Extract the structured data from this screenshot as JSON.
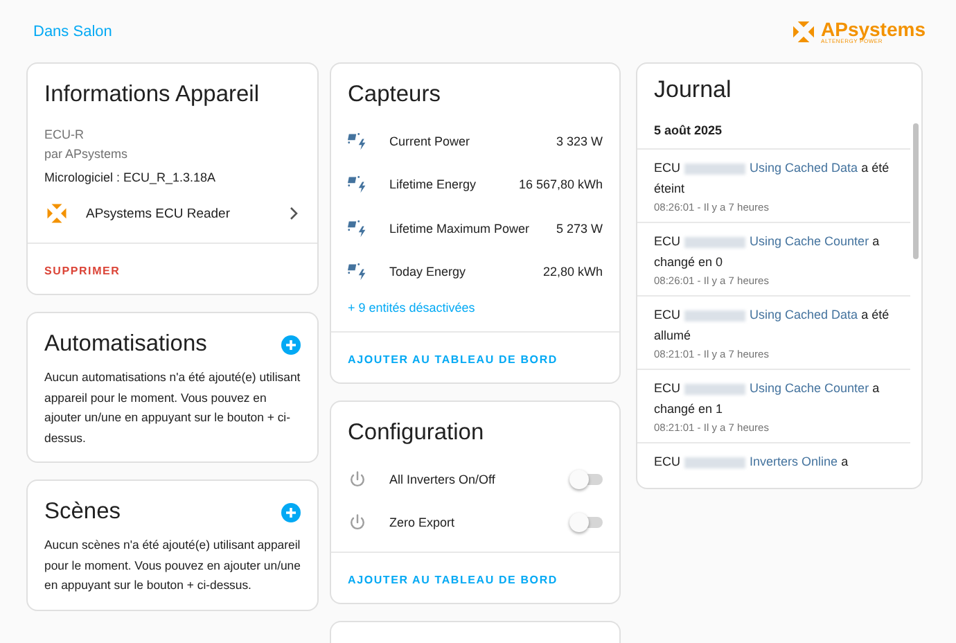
{
  "header": {
    "area_link": "Dans Salon",
    "logo": {
      "name": "APsystems",
      "tagline": "ALTENERGY POWER"
    }
  },
  "device_info": {
    "title": "Informations Appareil",
    "model": "ECU-R",
    "manufacturer": "par APsystems",
    "firmware": "Micrologiciel : ECU_R_1.3.18A",
    "integration": "APsystems ECU Reader",
    "delete_button": "SUPPRIMER"
  },
  "automations": {
    "title": "Automatisations",
    "text": "Aucun automatisations n'a été ajouté(e) utilisant appareil pour le moment. Vous pouvez en ajouter un/une en appuyant sur le bouton + ci-dessus."
  },
  "scenes": {
    "title": "Scènes",
    "text": "Aucun scènes n'a été ajouté(e) utilisant appareil pour le moment. Vous pouvez en ajouter un/une en appuyant sur le bouton + ci-dessus."
  },
  "sensors": {
    "title": "Capteurs",
    "items": [
      {
        "name": "Current Power",
        "value": "3 323 W"
      },
      {
        "name": "Lifetime Energy",
        "value": "16 567,80 kWh"
      },
      {
        "name": "Lifetime Maximum Power",
        "value": "5 273 W"
      },
      {
        "name": "Today Energy",
        "value": "22,80 kWh"
      }
    ],
    "disabled_link": "+ 9 entités désactivées",
    "add_button": "AJOUTER AU TABLEAU DE BORD"
  },
  "configuration": {
    "title": "Configuration",
    "items": [
      {
        "name": "All Inverters On/Off",
        "on": false
      },
      {
        "name": "Zero Export",
        "on": false
      }
    ],
    "add_button": "AJOUTER AU TABLEAU DE BORD"
  },
  "journal": {
    "title": "Journal",
    "date": "5 août 2025",
    "entries": [
      {
        "prefix": "ECU",
        "redacted": true,
        "entity": "Using Cached Data",
        "suffix": "a été éteint",
        "time": "08:26:01 - Il y a 7 heures"
      },
      {
        "prefix": "ECU",
        "redacted": true,
        "entity": "Using Cache Counter",
        "suffix": "a changé en 0",
        "time": "08:26:01 - Il y a 7 heures"
      },
      {
        "prefix": "ECU",
        "redacted": true,
        "entity": "Using Cached Data",
        "suffix": "a été allumé",
        "time": "08:21:01 - Il y a 7 heures"
      },
      {
        "prefix": "ECU",
        "redacted": true,
        "entity": "Using Cache Counter",
        "suffix": "a changé en 1",
        "time": "08:21:01 - Il y a 7 heures"
      },
      {
        "prefix": "ECU",
        "redacted": true,
        "entity": "Inverters Online",
        "suffix": "a"
      }
    ]
  }
}
